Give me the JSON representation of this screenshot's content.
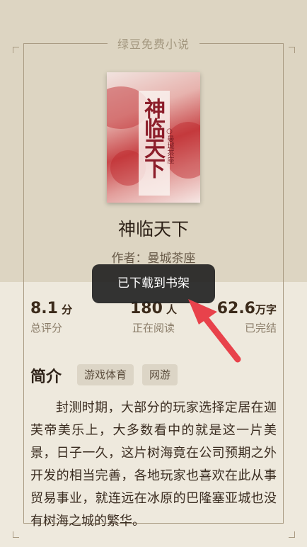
{
  "app": {
    "title": "绿豆免费小说"
  },
  "book": {
    "cover_title": "神临天下",
    "cover_author": "○曼城茶座",
    "title": "神临天下",
    "author_line": "作者：曼城茶座"
  },
  "stats": [
    {
      "value": "8.1",
      "unit": "分",
      "label": "总评分"
    },
    {
      "value": "180",
      "unit": "人",
      "label": "正在阅读"
    },
    {
      "value": "62.6",
      "unit": "万字",
      "label": "已完结"
    }
  ],
  "toast": {
    "message": "已下载到书架"
  },
  "intro": {
    "heading": "简介",
    "tags": [
      "游戏体育",
      "网游"
    ],
    "text": "封测时期，大部分的玩家选择定居在迦芙帝美乐上，大多数看中的就是这一片美景，日子一久，这片树海竟在公司预期之外开发的相当完善，各地玩家也喜欢在此从事贸易事业，就连远在冰原的巴隆塞亚城也没有树海之城的繁华。"
  },
  "colors": {
    "background_top": "#ddd5c2",
    "background_bottom": "#eee9dd",
    "toast_bg": "#232323",
    "annotation_arrow": "#e8424b"
  }
}
